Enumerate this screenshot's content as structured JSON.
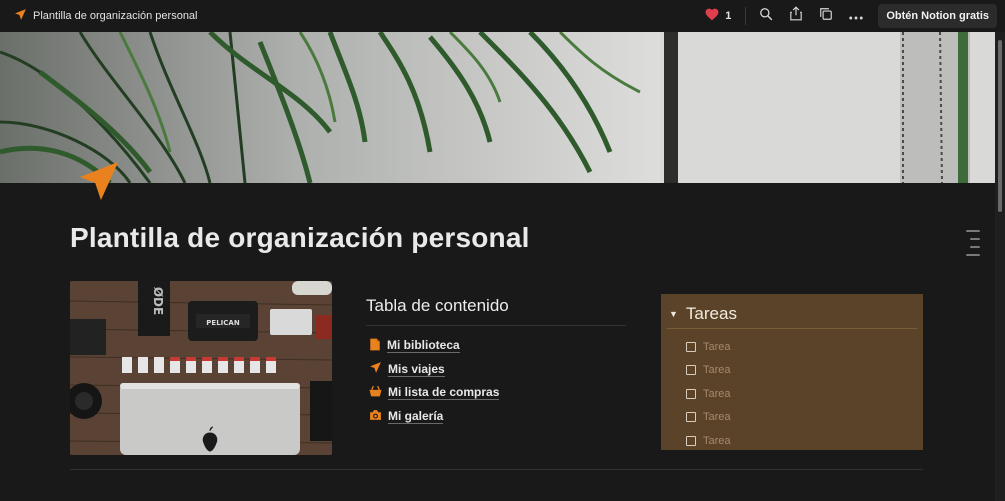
{
  "topbar": {
    "breadcrumb": "Plantilla de organización personal",
    "like_count": "1",
    "cta_label": "Obtén Notion gratis",
    "icons": [
      "paper-plane-icon",
      "heart-icon",
      "search-icon",
      "share-icon",
      "duplicate-icon",
      "more-icon"
    ]
  },
  "page": {
    "title": "Plantilla de organización personal",
    "accent": "#e8811e"
  },
  "toc": {
    "heading": "Tabla de contenido",
    "items": [
      {
        "label": "Mi biblioteca",
        "icon": "document-icon"
      },
      {
        "label": "Mis viajes",
        "icon": "paper-plane-icon"
      },
      {
        "label": "Mi lista de compras",
        "icon": "basket-icon"
      },
      {
        "label": "Mi galería",
        "icon": "camera-icon"
      }
    ]
  },
  "tasks": {
    "heading": "Tareas",
    "bg": "#5a4328",
    "items": [
      {
        "label": "Tarea",
        "checked": false
      },
      {
        "label": "Tarea",
        "checked": false
      },
      {
        "label": "Tarea",
        "checked": false
      },
      {
        "label": "Tarea",
        "checked": false
      },
      {
        "label": "Tarea",
        "checked": false
      }
    ]
  }
}
